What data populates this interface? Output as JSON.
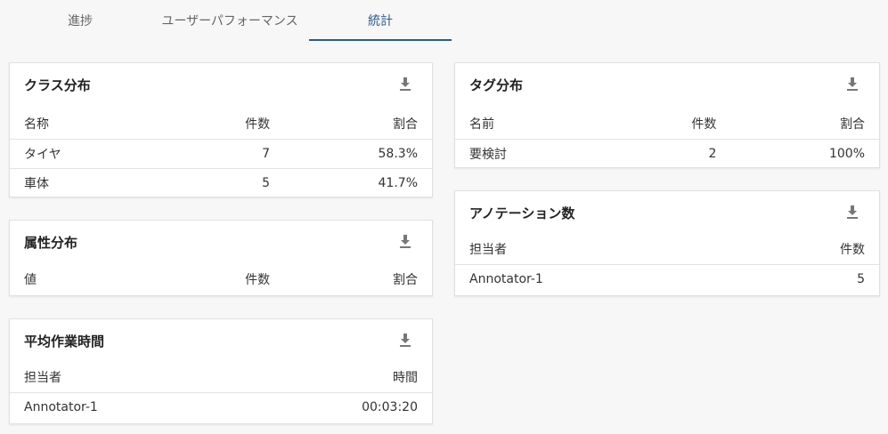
{
  "tabs": [
    {
      "label": "進捗"
    },
    {
      "label": "ユーザーパフォーマンス"
    },
    {
      "label": "統計"
    }
  ],
  "active_tab": "統計",
  "class_distribution": {
    "title": "クラス分布",
    "headers": [
      "名称",
      "件数",
      "割合"
    ],
    "rows": [
      {
        "name": "タイヤ",
        "count": "7",
        "ratio": "58.3%"
      },
      {
        "name": "車体",
        "count": "5",
        "ratio": "41.7%"
      }
    ]
  },
  "attribute_distribution": {
    "title": "属性分布",
    "headers": [
      "値",
      "件数",
      "割合"
    ]
  },
  "avg_work_time": {
    "title": "平均作業時間",
    "headers": [
      "担当者",
      "時間"
    ],
    "rows": [
      {
        "assignee": "Annotator-1",
        "time": "00:03:20"
      }
    ]
  },
  "tag_distribution": {
    "title": "タグ分布",
    "headers": [
      "名前",
      "件数",
      "割合"
    ],
    "rows": [
      {
        "name": "要検討",
        "count": "2",
        "ratio": "100%"
      }
    ]
  },
  "annotation_count": {
    "title": "アノテーション数",
    "headers": [
      "担当者",
      "件数"
    ],
    "rows": [
      {
        "assignee": "Annotator-1",
        "count": "5"
      }
    ]
  },
  "icons": {
    "download": "download-icon"
  },
  "colors": {
    "accent": "#2a5c8f",
    "background": "#f7f7f7"
  }
}
